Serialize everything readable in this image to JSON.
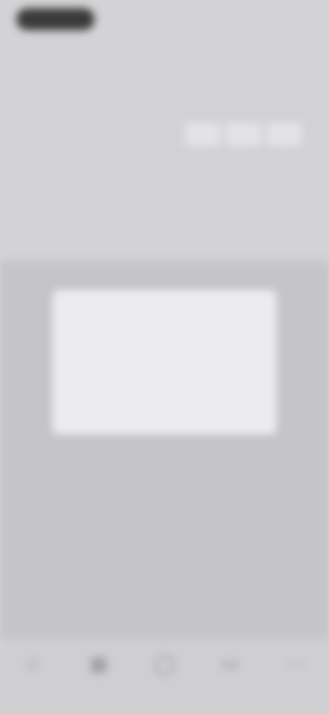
{
  "status_bar": {
    "right": ""
  },
  "navbar": {
    "back": "",
    "title": "",
    "right": ""
  },
  "settings": {
    "rows": [
      {
        "label": "",
        "value": ""
      },
      {
        "label": "",
        "segments": [
          "",
          "",
          ""
        ]
      },
      {
        "label": "",
        "value": ""
      },
      {
        "label": "",
        "value": ""
      },
      {
        "label": "",
        "value": ""
      }
    ]
  },
  "dialog": {
    "title": "",
    "message": "",
    "cancel_label": "",
    "confirm_label": ""
  },
  "tabbar": {
    "tabs": [
      {
        "label": "",
        "icon": "home-icon"
      },
      {
        "label": "",
        "icon": "grid-icon"
      },
      {
        "label": "",
        "icon": "user-icon"
      },
      {
        "label": "",
        "icon": "message-icon"
      },
      {
        "label": "",
        "icon": "more-icon"
      }
    ]
  },
  "colors": {
    "background": "#d3d3d6",
    "dialog": "#ececef",
    "accent": "#e5867e"
  }
}
